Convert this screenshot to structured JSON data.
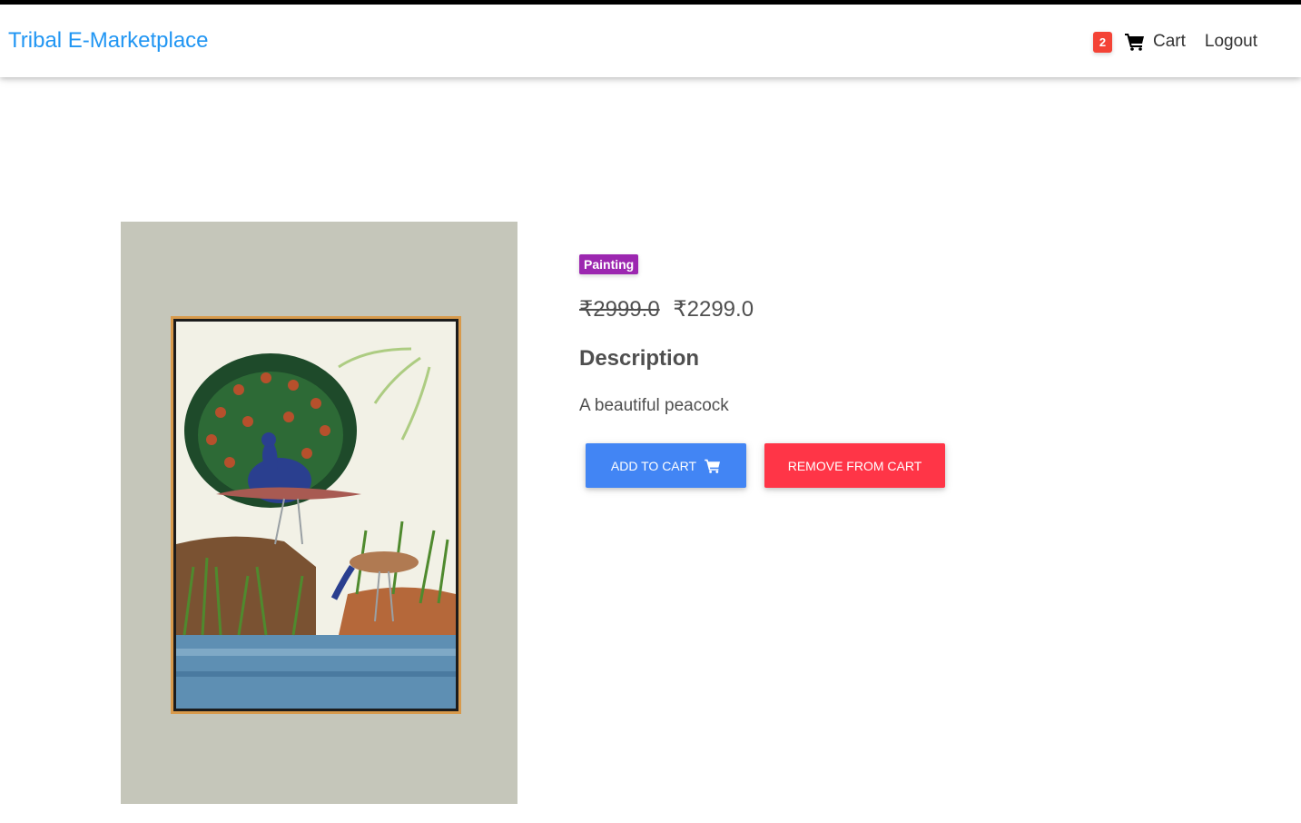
{
  "navbar": {
    "brand": "Tribal E-Marketplace",
    "cart_count": "2",
    "cart_label": "Cart",
    "logout_label": "Logout",
    "brand_color": "#2196f3"
  },
  "product": {
    "category": "Painting",
    "price_original": "₹2999.0",
    "price_current": "₹2299.0",
    "description_heading": "Description",
    "description": "A beautiful peacock",
    "image_alt": "Peacock painting"
  },
  "actions": {
    "add_to_cart": "ADD TO CART",
    "remove_from_cart": "REMOVE FROM CART"
  },
  "colors": {
    "badge_red": "#f44336",
    "category_purple": "#9c27b0",
    "add_blue": "#4285f4",
    "remove_red": "#ff3547"
  }
}
